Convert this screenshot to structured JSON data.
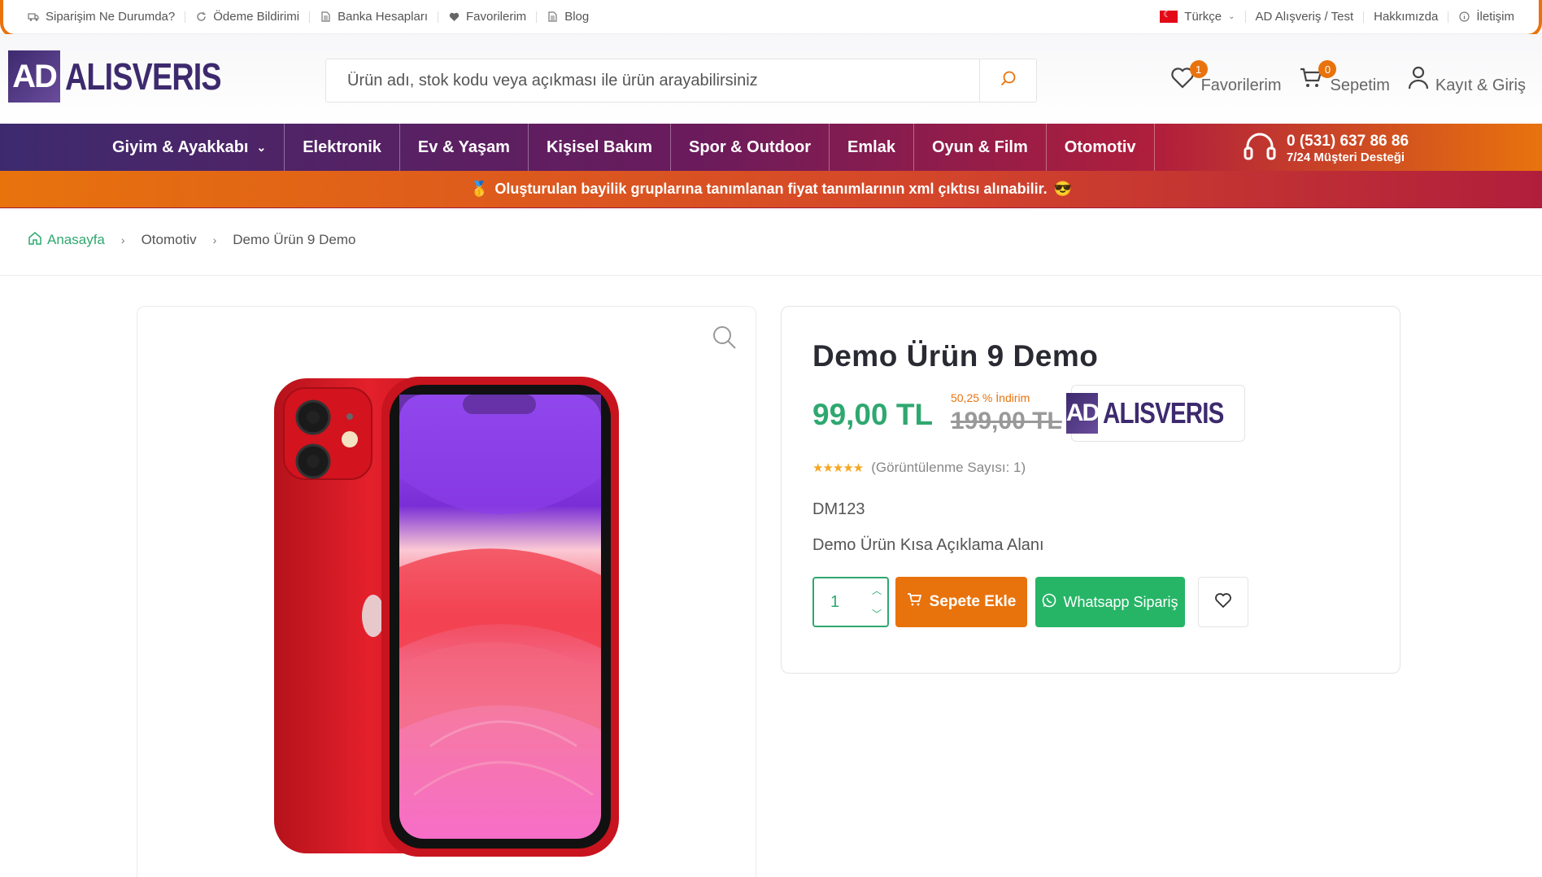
{
  "topbar": {
    "left": [
      {
        "label": "Siparişim Ne Durumda?",
        "icon": "truck-icon"
      },
      {
        "label": "Ödeme Bildirimi",
        "icon": "refresh-icon"
      },
      {
        "label": "Banka Hesapları",
        "icon": "document-icon"
      },
      {
        "label": "Favorilerim",
        "icon": "heart-icon"
      },
      {
        "label": "Blog",
        "icon": "document-icon"
      }
    ],
    "language": "Türkçe",
    "right": [
      {
        "label": "AD Alışveriş / Test"
      },
      {
        "label": "Hakkımızda"
      },
      {
        "label": "İletişim",
        "icon": "info-icon"
      }
    ]
  },
  "header": {
    "logo_mark": "AD",
    "logo_text": "ALISVERIS",
    "search_placeholder": "Ürün adı, stok kodu veya açıkması ile ürün arayabilirsiniz",
    "favorites": {
      "label": "Favorilerim",
      "count": "1"
    },
    "cart": {
      "label": "Sepetim",
      "count": "0"
    },
    "account": {
      "label": "Kayıt & Giriş"
    }
  },
  "nav": {
    "items": [
      {
        "label": "Giyim & Ayakkabı",
        "has_dropdown": true
      },
      {
        "label": "Elektronik"
      },
      {
        "label": "Ev & Yaşam"
      },
      {
        "label": "Kişisel Bakım"
      },
      {
        "label": "Spor & Outdoor"
      },
      {
        "label": "Emlak"
      },
      {
        "label": "Oyun & Film"
      },
      {
        "label": "Otomotiv"
      }
    ],
    "support_phone": "0 (531) 637 86 86",
    "support_text": "7/24 Müşteri Desteği"
  },
  "announcement": {
    "prefix_emoji": "🥇",
    "text": "Oluşturulan bayilik gruplarına tanımlanan fiyat tanımlarının xml çıktısı alınabilir.",
    "suffix_emoji": "😎"
  },
  "breadcrumb": [
    {
      "label": "Anasayfa"
    },
    {
      "label": "Otomotiv"
    },
    {
      "label": "Demo Ürün 9 Demo"
    }
  ],
  "product": {
    "title": "Demo Ürün 9 Demo",
    "price": "99,00 TL",
    "discount": "50,25 % İndirim",
    "old_price": "199,00 TL",
    "brand_mark": "AD",
    "brand_text": "ALISVERIS",
    "rating_stars": 5,
    "views": "(Görüntülenme Sayısı: 1)",
    "sku": "DM123",
    "short_description": "Demo Ürün Kısa Açıklama Alanı",
    "quantity": "1",
    "add_to_cart": "Sepete Ekle",
    "whatsapp": "Whatsapp Sipariş"
  },
  "colors": {
    "accent_orange": "#e8730d",
    "accent_purple": "#3d2a6e",
    "price_green": "#2fa870",
    "whatsapp_green": "#26b566"
  }
}
